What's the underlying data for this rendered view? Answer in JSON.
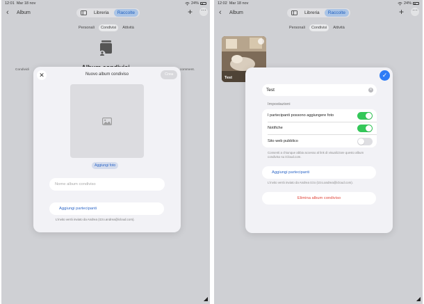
{
  "left": {
    "status": {
      "time": "12:01",
      "date": "Mar 18 nov",
      "battery": "24%"
    },
    "nav": {
      "back_label": "Album",
      "tabs": [
        "Libreria",
        "Raccolte"
      ],
      "active_tab": "Raccolte"
    },
    "subtabs": [
      "Personali",
      "Condivisi",
      "Attività"
    ],
    "active_subtab": "Condivisi",
    "background": {
      "title": "Album condivisi",
      "line_left": "Condividi",
      "line_right": "comment."
    },
    "modal": {
      "title": "Nuovo album condiviso",
      "create_label": "Crea",
      "add_photo_label": "Aggiungi foto",
      "name_placeholder": "Nome album condiviso",
      "add_participants_label": "Aggiungi partecipanti",
      "invite_note": "L'invito verrà inviato da Andrea (Izzo.andrea@icloud.com)."
    }
  },
  "right": {
    "status": {
      "time": "12:02",
      "date": "Mar 18 nov",
      "battery": "24%"
    },
    "nav": {
      "back_label": "Album",
      "tabs": [
        "Libreria",
        "Raccolte"
      ],
      "active_tab": "Raccolte"
    },
    "subtabs": [
      "Personali",
      "Condivisi",
      "Attività"
    ],
    "active_subtab": "Condivisi",
    "album_thumb": {
      "label": "Test"
    },
    "modal": {
      "name_value": "Test",
      "settings_header": "Impostazioni",
      "settings": [
        {
          "label": "I partecipanti possono aggiungere foto",
          "on": true
        },
        {
          "label": "Notifiche",
          "on": true
        },
        {
          "label": "Sito web pubblico",
          "on": false
        }
      ],
      "public_site_note": "Consenti a chiunque abbia accesso al link di visualizzare questo album condiviso su iCloud.com.",
      "add_participants_label": "Aggiungi partecipanti",
      "invite_note": "L'invito verrà inviato da Andrea Izzo (Izzo.andrea@icloud.com).",
      "delete_label": "Elimina album condiviso"
    }
  },
  "colors": {
    "accent": "#2f7cf6",
    "toggle_on": "#34c759",
    "destructive": "#e0453a",
    "link": "#2f68c8"
  }
}
